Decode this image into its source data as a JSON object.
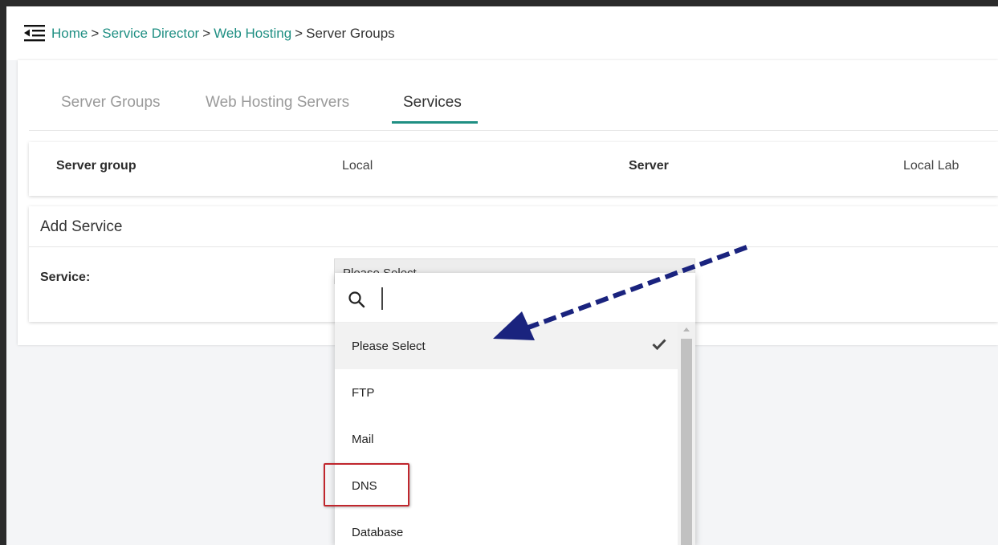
{
  "breadcrumb": {
    "home": "Home",
    "service_director": "Service Director",
    "web_hosting": "Web Hosting",
    "current": "Server Groups",
    "separator": ">"
  },
  "tabs": [
    {
      "label": "Server Groups"
    },
    {
      "label": "Web Hosting Servers"
    },
    {
      "label": "Services"
    }
  ],
  "info": {
    "server_group_label": "Server group",
    "server_group_value": "Local",
    "server_label": "Server",
    "server_value": "Local Lab"
  },
  "add_service": {
    "title": "Add Service",
    "service_label": "Service:",
    "selected_value": "Please Select"
  },
  "dropdown": {
    "search_value": "",
    "options": [
      {
        "label": "Please Select",
        "selected": true
      },
      {
        "label": "FTP",
        "selected": false
      },
      {
        "label": "Mail",
        "selected": false
      },
      {
        "label": "DNS",
        "selected": false
      },
      {
        "label": "Database",
        "selected": false
      }
    ]
  },
  "colors": {
    "accent": "#1f8f83",
    "highlight": "#c0262d",
    "annotation_arrow": "#1a237e"
  },
  "icons": {
    "menu": "menu-collapse-icon",
    "search": "search-icon",
    "check": "check-icon"
  }
}
